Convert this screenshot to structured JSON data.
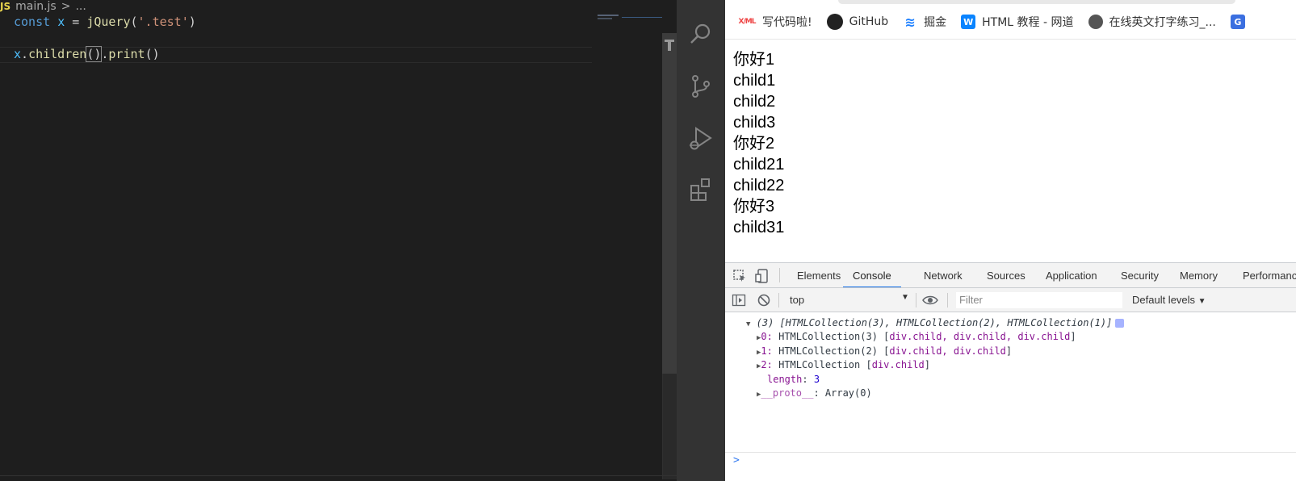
{
  "editor": {
    "breadcrumb_badge": "JS",
    "breadcrumb_file": "main.js",
    "breadcrumb_sep": ">",
    "breadcrumb_more": "...",
    "line1": {
      "kw": "const",
      "var": "x",
      "eq": "=",
      "fn": "jQuery",
      "open": "(",
      "str": "'.test'",
      "close": ")"
    },
    "line2": {
      "var": "x",
      "dot1": ".",
      "fn1": "children",
      "paren": "()",
      "dot2": ".",
      "fn2": "print",
      "paren2": "()"
    }
  },
  "activity": {
    "icons": [
      "search-icon",
      "source-control-icon",
      "run-debug-icon",
      "extensions-icon"
    ]
  },
  "bookmarks": [
    {
      "icon": "xml-icon",
      "label": "写代码啦!"
    },
    {
      "icon": "github-icon",
      "label": "GitHub"
    },
    {
      "icon": "juejin-icon",
      "label": "掘金"
    },
    {
      "icon": "w3school-icon",
      "label": "HTML 教程 - 网道"
    },
    {
      "icon": "globe-icon",
      "label": "在线英文打字练习_..."
    }
  ],
  "page_lines": [
    "你好1",
    "child1",
    "child2",
    "child3",
    "你好2",
    "child21",
    "child22",
    "你好3",
    "child31"
  ],
  "devtools": {
    "tabs": [
      "Elements",
      "Console",
      "Network",
      "Sources",
      "Application",
      "Security",
      "Memory",
      "Performanc"
    ],
    "active_tab": "Console",
    "context": "top",
    "filter_placeholder": "Filter",
    "levels": "Default levels",
    "console": {
      "summary": "(3) [HTMLCollection(3), HTMLCollection(2), HTMLCollection(1)]",
      "rows": [
        {
          "idx": "0",
          "type": "HTMLCollection(3)",
          "open": "[",
          "items": "div.child, div.child, div.child",
          "close": "]"
        },
        {
          "idx": "1",
          "type": "HTMLCollection(2)",
          "open": "[",
          "items": "div.child, div.child",
          "close": "]"
        },
        {
          "idx": "2",
          "type": "HTMLCollection",
          "open": "[",
          "items": "div.child",
          "close": "]"
        }
      ],
      "length_key": "length",
      "length_val": "3",
      "proto_key": "__proto__",
      "proto_val": "Array(0)",
      "prompt": ">"
    }
  }
}
